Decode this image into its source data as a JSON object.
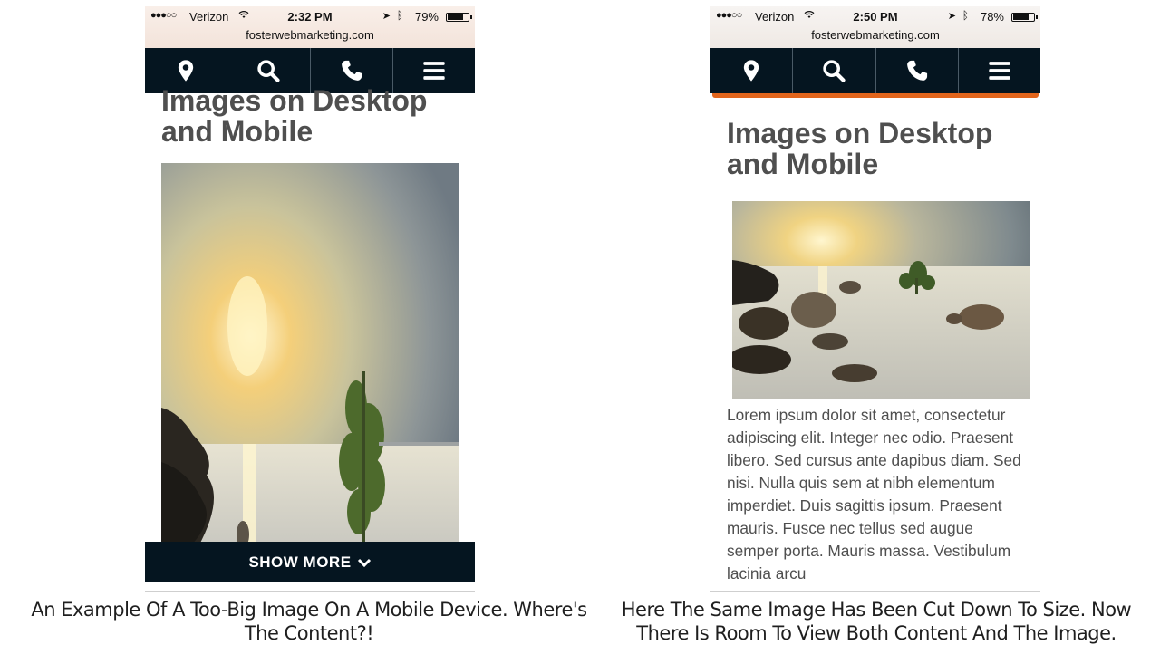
{
  "left_phone": {
    "status": {
      "carrier": "Verizon",
      "time": "2:32 PM",
      "battery": "79%",
      "battery_level": 0.79
    },
    "url": "fosterwebmarketing.com",
    "title": "Images on Desktop and Mobile",
    "show_more": "SHOW MORE"
  },
  "right_phone": {
    "status": {
      "carrier": "Verizon",
      "time": "2:50 PM",
      "battery": "78%",
      "battery_level": 0.78
    },
    "url": "fosterwebmarketing.com",
    "title": "Images on Desktop and Mobile",
    "body_text": "Lorem ipsum dolor sit amet, consectetur adipiscing elit. Integer nec odio. Praesent libero. Sed cursus ante dapibus diam. Sed nisi. Nulla quis sem at nibh elementum imperdiet. Duis sagittis ipsum. Praesent mauris. Fusce nec tellus sed augue semper porta. Mauris massa. Vestibulum lacinia arcu"
  },
  "nav_icons": [
    "map-pin-icon",
    "search-icon",
    "phone-icon",
    "menu-icon"
  ],
  "captions": {
    "left": "An Example Of A Too-Big Image On A Mobile Device. Where's The Content?!",
    "right": "Here The Same Image Has Been Cut Down To Size. Now There Is Room To View Both Content And The Image."
  },
  "colors": {
    "navbar": "#051520",
    "accent": "#e2651c",
    "title_text": "#4f4f4f"
  }
}
